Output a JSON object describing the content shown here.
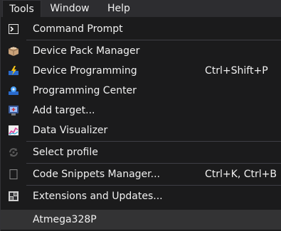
{
  "menubar": {
    "items": [
      {
        "label": "Tools"
      },
      {
        "label": "Window"
      },
      {
        "label": "Help"
      }
    ]
  },
  "menu": {
    "items": [
      {
        "label": "Command Prompt",
        "shortcut": "",
        "icon": "command-prompt-icon"
      },
      {
        "label": "Device Pack Manager",
        "shortcut": "",
        "icon": "package-box-icon"
      },
      {
        "label": "Device Programming",
        "shortcut": "Ctrl+Shift+P",
        "icon": "device-programming-icon"
      },
      {
        "label": "Programming Center",
        "shortcut": "",
        "icon": "programming-center-icon"
      },
      {
        "label": "Add target...",
        "shortcut": "",
        "icon": "add-target-icon"
      },
      {
        "label": "Data Visualizer",
        "shortcut": "",
        "icon": "data-visualizer-icon"
      },
      {
        "label": "Select profile",
        "shortcut": "",
        "icon": "select-profile-icon"
      },
      {
        "label": "Code Snippets Manager...",
        "shortcut": "Ctrl+K, Ctrl+B",
        "icon": "code-snippets-icon"
      },
      {
        "label": "Extensions and Updates...",
        "shortcut": "",
        "icon": "extensions-icon"
      },
      {
        "label": "Atmega328P",
        "shortcut": "",
        "icon": ""
      }
    ]
  },
  "colors": {
    "menu_background": "#1b1b1c",
    "menubar_background": "#2d2d30",
    "hover_background": "#333334",
    "separator": "#3f3f46",
    "text": "#f1f1f1"
  }
}
